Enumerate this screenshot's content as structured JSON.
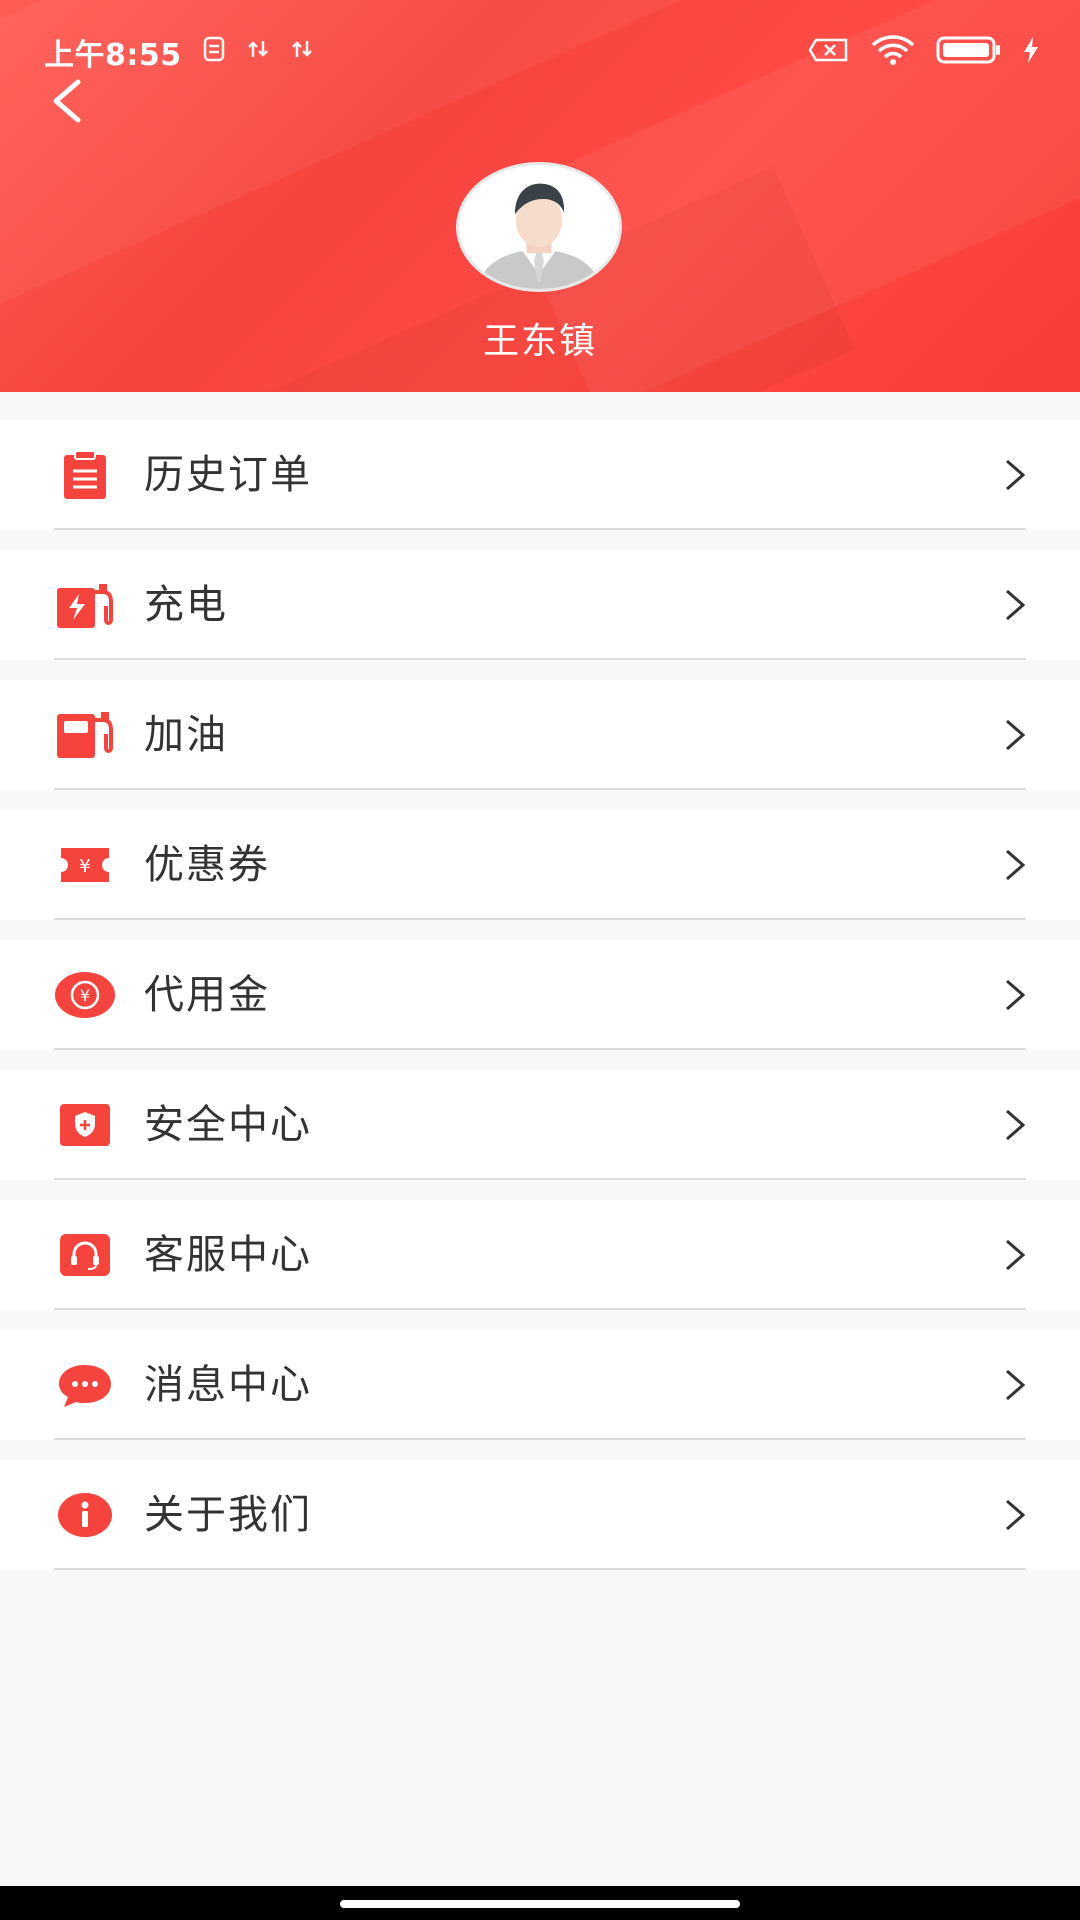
{
  "status": {
    "time": "上午8:55",
    "indicators": [
      "sim-icon",
      "data-arrows-icon",
      "data-arrows-icon"
    ],
    "right_icons": [
      "no-sim-icon",
      "wifi-icon",
      "battery-icon",
      "charging-icon"
    ]
  },
  "profile": {
    "name": "王东镇"
  },
  "colors": {
    "accent": "#f5443e",
    "text": "#333333"
  },
  "menu": [
    {
      "label": "历史订单",
      "icon": "clipboard-icon"
    },
    {
      "label": "充电",
      "icon": "charging-station-icon"
    },
    {
      "label": "加油",
      "icon": "fuel-pump-icon"
    },
    {
      "label": "优惠券",
      "icon": "coupon-icon"
    },
    {
      "label": "代用金",
      "icon": "yuan-coin-icon"
    },
    {
      "label": "安全中心",
      "icon": "shield-icon"
    },
    {
      "label": "客服中心",
      "icon": "headset-icon"
    },
    {
      "label": "消息中心",
      "icon": "chat-bubble-icon"
    },
    {
      "label": "关于我们",
      "icon": "info-icon"
    }
  ]
}
